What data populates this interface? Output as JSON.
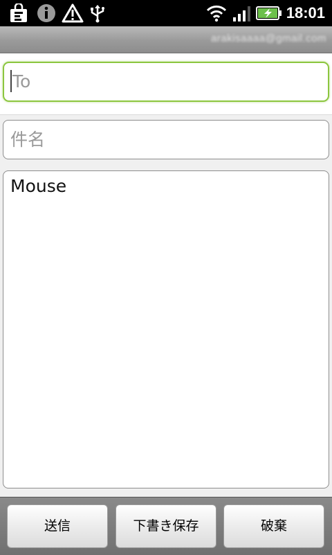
{
  "status_bar": {
    "time": "18:01",
    "icons": [
      "shopping-bag-icon",
      "info-icon",
      "warning-icon",
      "usb-icon",
      "wifi-icon",
      "signal-icon",
      "battery-charging-icon"
    ]
  },
  "account": {
    "email": "arakisaaaa@gmail.com"
  },
  "compose": {
    "to_placeholder": "To",
    "subject_placeholder": "件名",
    "body_value": "Mouse"
  },
  "buttons": {
    "send": "送信",
    "save_draft": "下書き保存",
    "discard": "破棄"
  },
  "colors": {
    "focus_border": "#8cc63f",
    "status_bar_bg": "#000000",
    "battery_fill": "#6cc04a"
  }
}
